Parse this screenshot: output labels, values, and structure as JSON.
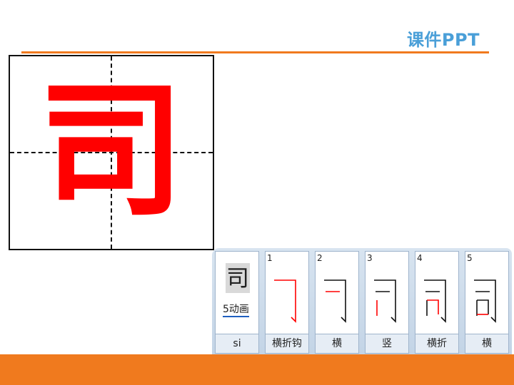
{
  "header": {
    "brand": "课件PPT",
    "accent_color": "#f07a1e",
    "brand_color": "#4a9fd8"
  },
  "character": {
    "glyph": "司",
    "color": "#ff0000"
  },
  "stroke_panel": {
    "summary": {
      "glyph": "司",
      "stroke_count_label": "5动画",
      "pinyin": "si"
    },
    "strokes": [
      {
        "number": "1",
        "name": "横折钩"
      },
      {
        "number": "2",
        "name": "横"
      },
      {
        "number": "3",
        "name": "竖"
      },
      {
        "number": "4",
        "name": "横折"
      },
      {
        "number": "5",
        "name": "横"
      }
    ]
  }
}
